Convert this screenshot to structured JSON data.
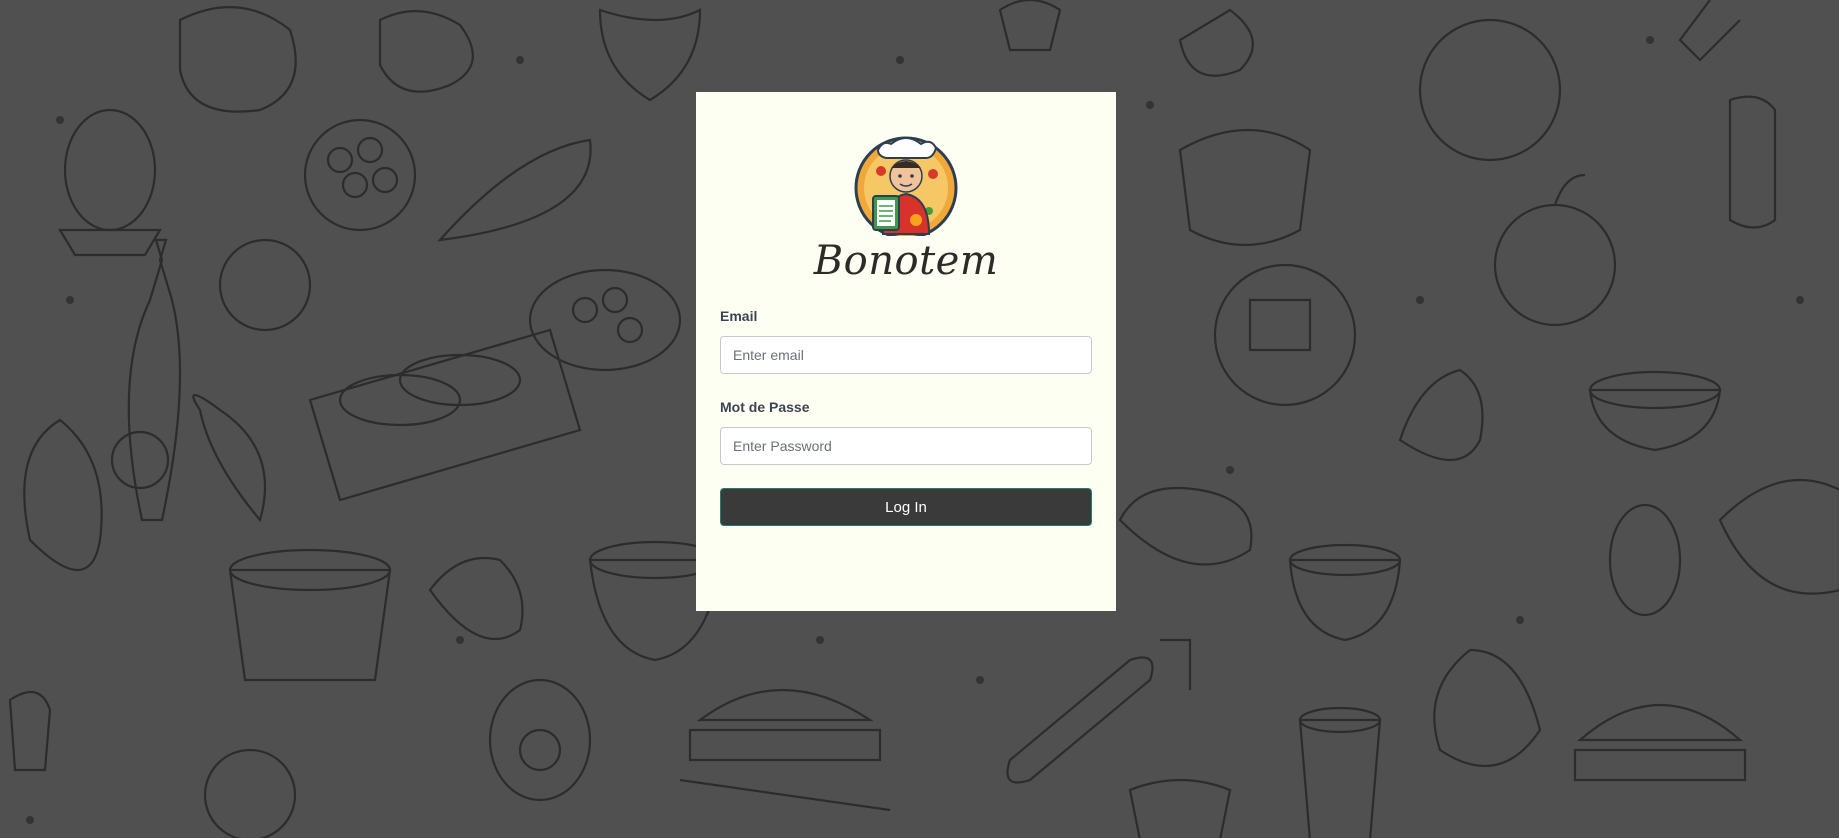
{
  "brand": {
    "name": "Bonotem",
    "logo_icon": "chef-mascot-icon"
  },
  "form": {
    "email_label": "Email",
    "email_placeholder": "Enter email",
    "email_value": "",
    "password_label": "Mot de Passe",
    "password_placeholder": "Enter Password",
    "password_value": "",
    "login_label": "Log In"
  },
  "colors": {
    "background": "#505050",
    "card": "#fefff3",
    "button": "#3a3a3a",
    "button_border": "#1d7f72"
  }
}
